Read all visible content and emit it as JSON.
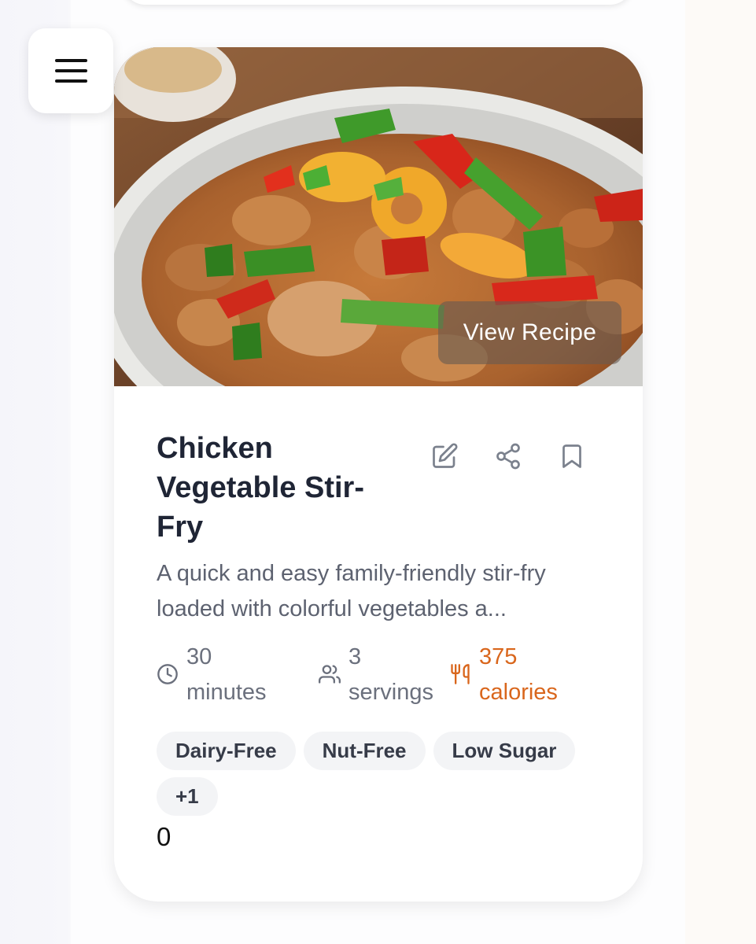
{
  "menu": {
    "icon": "hamburger-menu-icon"
  },
  "card": {
    "overlay_button": "View Recipe",
    "title": "Chicken Vegetable Stir-Fry",
    "actions": [
      {
        "name": "edit",
        "icon": "edit-icon"
      },
      {
        "name": "share",
        "icon": "share-icon"
      },
      {
        "name": "bookmark",
        "icon": "bookmark-icon"
      }
    ],
    "description": "A quick and easy family-friendly stir-fry loaded with colorful vegetables a...",
    "meta": {
      "time": {
        "value": "30",
        "unit": "minutes",
        "icon": "clock-icon"
      },
      "servings": {
        "value": "3",
        "unit": "servings",
        "icon": "users-icon"
      },
      "calories": {
        "value": "375",
        "unit": "calories",
        "icon": "utensils-icon",
        "color": "#d9661c"
      }
    },
    "tags": [
      "Dairy-Free",
      "Nut-Free",
      "Low Sugar",
      "+1"
    ],
    "count": "0"
  },
  "colors": {
    "title": "#1f2535",
    "text_muted": "#6b707d",
    "accent": "#d9661c",
    "tag_bg": "#f3f4f6"
  }
}
